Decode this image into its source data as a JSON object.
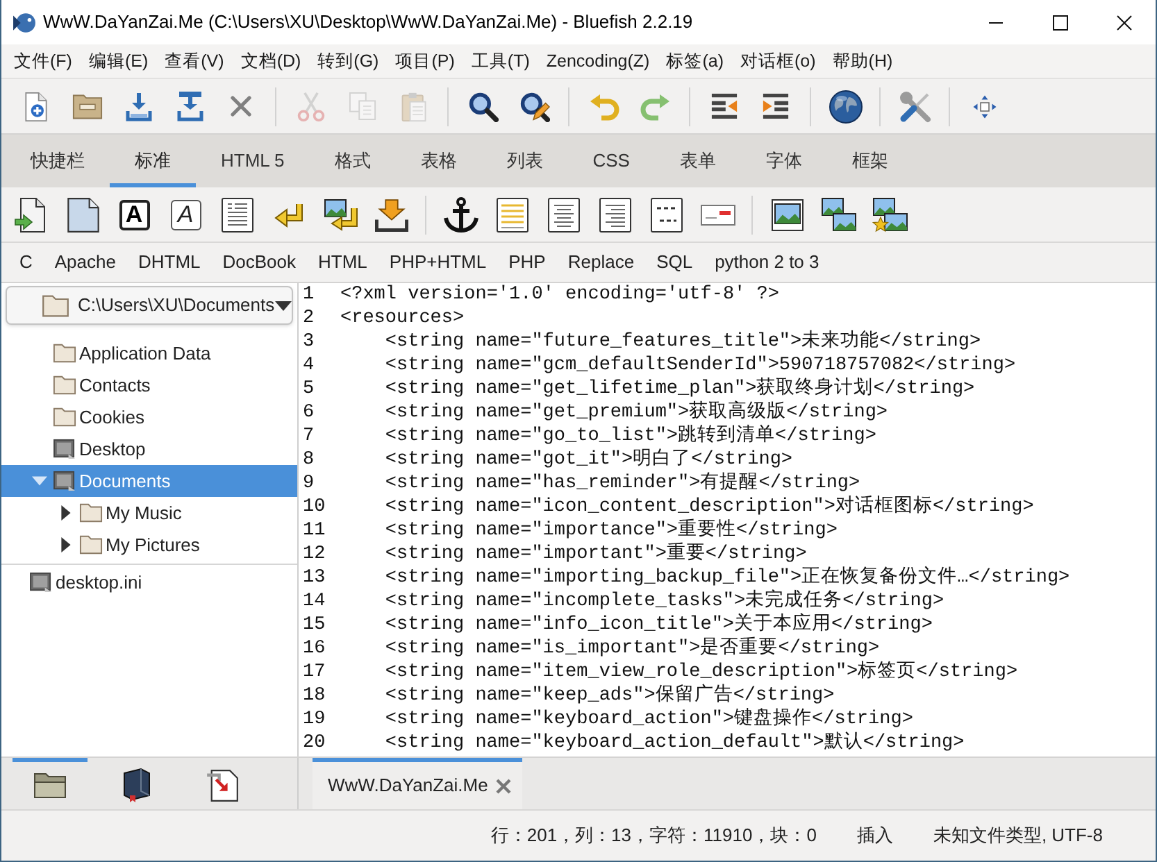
{
  "window": {
    "title": "WwW.DaYanZai.Me (C:\\Users\\XU\\Desktop\\WwW.DaYanZai.Me) - Bluefish 2.2.19"
  },
  "menu": [
    "文件(F)",
    "编辑(E)",
    "查看(V)",
    "文档(D)",
    "转到(G)",
    "项目(P)",
    "工具(T)",
    "Zencoding(Z)",
    "标签(a)",
    "对话框(o)",
    "帮助(H)"
  ],
  "toolbar": {
    "groups": [
      {
        "buttons": [
          {
            "kind": "new",
            "disabled": false
          },
          {
            "kind": "open",
            "disabled": false
          },
          {
            "kind": "save",
            "disabled": false
          },
          {
            "kind": "saveas",
            "disabled": false
          },
          {
            "kind": "close",
            "disabled": false
          }
        ]
      },
      {
        "buttons": [
          {
            "kind": "cut",
            "disabled": true
          },
          {
            "kind": "copy",
            "disabled": true
          },
          {
            "kind": "paste",
            "disabled": true
          }
        ]
      },
      {
        "buttons": [
          {
            "kind": "find",
            "disabled": false
          },
          {
            "kind": "replace",
            "disabled": false
          }
        ]
      },
      {
        "buttons": [
          {
            "kind": "undo",
            "disabled": false
          },
          {
            "kind": "redo",
            "disabled": false
          }
        ]
      },
      {
        "buttons": [
          {
            "kind": "unindent",
            "disabled": false
          },
          {
            "kind": "indent",
            "disabled": false
          }
        ]
      },
      {
        "buttons": [
          {
            "kind": "preview",
            "disabled": false
          }
        ]
      },
      {
        "buttons": [
          {
            "kind": "tools",
            "disabled": false
          }
        ]
      },
      {
        "buttons": [
          {
            "kind": "fullscreen",
            "disabled": false
          }
        ]
      }
    ]
  },
  "tabs": [
    {
      "label": "快捷栏",
      "selected": false
    },
    {
      "label": "标准",
      "selected": true
    },
    {
      "label": "HTML 5",
      "selected": false
    },
    {
      "label": "格式",
      "selected": false
    },
    {
      "label": "表格",
      "selected": false
    },
    {
      "label": "列表",
      "selected": false
    },
    {
      "label": "CSS",
      "selected": false
    },
    {
      "label": "表单",
      "selected": false
    },
    {
      "label": "字体",
      "selected": false
    },
    {
      "label": "框架",
      "selected": false
    }
  ],
  "tag_toolbar": {
    "groups": [
      {
        "buttons": [
          {
            "kind": "quickstart"
          },
          {
            "kind": "body"
          },
          {
            "kind": "bold",
            "glyph": "A"
          },
          {
            "kind": "italic",
            "glyph": "A"
          },
          {
            "kind": "paragraph"
          },
          {
            "kind": "break"
          },
          {
            "kind": "imagebreak"
          },
          {
            "kind": "tray"
          }
        ]
      },
      {
        "buttons": [
          {
            "kind": "anchor"
          },
          {
            "kind": "rule"
          },
          {
            "kind": "center"
          },
          {
            "kind": "right"
          },
          {
            "kind": "comment"
          },
          {
            "kind": "email"
          }
        ]
      },
      {
        "buttons": [
          {
            "kind": "image"
          },
          {
            "kind": "thumbnail"
          },
          {
            "kind": "multithumbnail"
          }
        ]
      }
    ]
  },
  "custom_menu": [
    "C",
    "Apache",
    "DHTML",
    "DocBook",
    "HTML",
    "PHP+HTML",
    "PHP",
    "Replace",
    "SQL",
    "python 2 to 3"
  ],
  "side_panel": {
    "path": "C:\\Users\\XU\\Documents",
    "tree": [
      {
        "label": "Application Data",
        "kind": "folder",
        "selected": false
      },
      {
        "label": "Contacts",
        "kind": "folder",
        "selected": false
      },
      {
        "label": "Cookies",
        "kind": "folder",
        "selected": false
      },
      {
        "label": "Desktop",
        "kind": "system",
        "selected": false
      },
      {
        "label": "Documents",
        "kind": "system",
        "selected": true,
        "expanded": true,
        "children": [
          {
            "label": "My Music",
            "kind": "folder",
            "selected": false,
            "expanded": false
          },
          {
            "label": "My Pictures",
            "kind": "folder",
            "selected": false,
            "expanded": false
          }
        ]
      }
    ],
    "files": [
      {
        "label": "desktop.ini",
        "kind": "system"
      }
    ]
  },
  "editor": {
    "lines": [
      {
        "number": "1",
        "code": "<?xml version='1.0' encoding='utf-8' ?>"
      },
      {
        "number": "2",
        "code": "<resources>",
        "children": [
          {
            "number": "3",
            "code": "<string name=\"future_features_title\">未来功能</string>"
          },
          {
            "number": "4",
            "code": "<string name=\"gcm_defaultSenderId\">590718757082</string>"
          },
          {
            "number": "5",
            "code": "<string name=\"get_lifetime_plan\">获取终身计划</string>"
          },
          {
            "number": "6",
            "code": "<string name=\"get_premium\">获取高级版</string>"
          },
          {
            "number": "7",
            "code": "<string name=\"go_to_list\">跳转到清单</string>"
          },
          {
            "number": "8",
            "code": "<string name=\"got_it\">明白了</string>"
          },
          {
            "number": "9",
            "code": "<string name=\"has_reminder\">有提醒</string>"
          },
          {
            "number": "10",
            "code": "<string name=\"icon_content_description\">对话框图标</string>"
          },
          {
            "number": "11",
            "code": "<string name=\"importance\">重要性</string>"
          },
          {
            "number": "12",
            "code": "<string name=\"important\">重要</string>"
          },
          {
            "number": "13",
            "code": "<string name=\"importing_backup_file\">正在恢复备份文件…</string>"
          },
          {
            "number": "14",
            "code": "<string name=\"incomplete_tasks\">未完成任务</string>"
          },
          {
            "number": "15",
            "code": "<string name=\"info_icon_title\">关于本应用</string>"
          },
          {
            "number": "16",
            "code": "<string name=\"is_important\">是否重要</string>"
          },
          {
            "number": "17",
            "code": "<string name=\"item_view_role_description\">标签页</string>"
          },
          {
            "number": "18",
            "code": "<string name=\"keep_ads\">保留广告</string>"
          },
          {
            "number": "19",
            "code": "<string name=\"keyboard_action\">键盘操作</string>"
          },
          {
            "number": "20",
            "code": "<string name=\"keyboard_action_default\">默认</string>"
          }
        ]
      }
    ]
  },
  "side_tabs": [
    {
      "kind": "folder",
      "selected": true
    },
    {
      "kind": "book",
      "selected": false
    },
    {
      "kind": "document",
      "selected": false
    }
  ],
  "document_tabs": [
    {
      "label": "WwW.DaYanZai.Me",
      "selected": true
    }
  ],
  "status_bar": {
    "position": "行：201，列：13，字符：11910，块：0",
    "mode": "插入",
    "file_type": "未知文件类型, UTF-8"
  }
}
